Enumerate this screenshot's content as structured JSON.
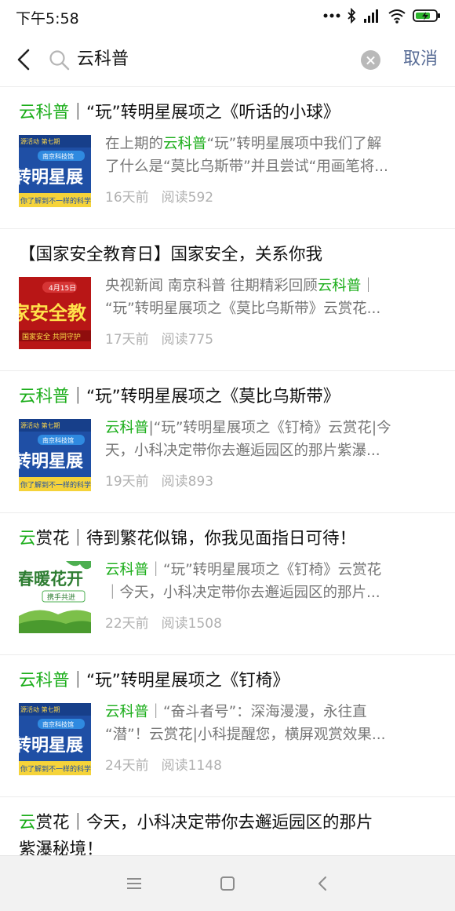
{
  "status_bar": {
    "time": "下午5:58"
  },
  "search": {
    "query": "云科普",
    "cancel_label": "取消"
  },
  "results": [
    {
      "title_hl": "云科普",
      "title_rest": "｜“玩”转明星展项之《听话的小球》",
      "snippet_line1_pre": "在上期的",
      "snippet_line1_hl": "云科普",
      "snippet_line1_post": "“玩”转明星展项中我们了解",
      "snippet_line2": "了什么是“莫比乌斯带”并且尝试“用画笔将...",
      "days": "16天前",
      "reads": "阅读592",
      "thumb": "blue"
    },
    {
      "title_hl": "",
      "title_rest": "【国家安全教育日】国家安全，关系你我",
      "snippet_line1_pre": "央视新闻 南京科普 往期精彩回顾",
      "snippet_line1_hl": "云科普",
      "snippet_line1_post": "｜",
      "snippet_line2": "“玩”转明星展项之《莫比乌斯带》云赏花...",
      "days": "17天前",
      "reads": "阅读775",
      "thumb": "red"
    },
    {
      "title_hl": "云科普",
      "title_rest": "｜“玩”转明星展项之《莫比乌斯带》",
      "snippet_line1_pre": "",
      "snippet_line1_hl": "云科普",
      "snippet_line1_post": "|“玩”转明星展项之《钉椅》云赏花|今",
      "snippet_line2": "天，小科决定带你去邂逅园区的那片紫瀑...",
      "days": "19天前",
      "reads": "阅读893",
      "thumb": "blue"
    },
    {
      "title_hl": "云",
      "title_rest": "赏花｜待到繁花似锦，你我见面指日可待！",
      "snippet_line1_pre": "",
      "snippet_line1_hl": "云科普",
      "snippet_line1_post": "｜“玩”转明星展项之《钉椅》云赏花",
      "snippet_line2": "｜今天，小科决定带你去邂逅园区的那片...",
      "days": "22天前",
      "reads": "阅读1508",
      "thumb": "green"
    },
    {
      "title_hl": "云科普",
      "title_rest": "｜“玩”转明星展项之《钉椅》",
      "snippet_line1_pre": "",
      "snippet_line1_hl": "云科普",
      "snippet_line1_post": "｜“奋斗者号”：深海漫漫，永往直",
      "snippet_line2": "“潜”！云赏花|小科提醒您，横屏观赏效果...",
      "days": "24天前",
      "reads": "阅读1148",
      "thumb": "blue"
    }
  ],
  "last_result": {
    "title_hl": "云",
    "title_rest": "赏花｜今天，小科决定带你去邂逅园区的那片",
    "title_line2": "紫瀑秘境！"
  },
  "thumbnails": {
    "blue": {
      "top_text": "源活动 第七期",
      "tag_text": "南京科技馆",
      "big_text": "转明星展",
      "bottom_text": "你了解到不一样的科学知"
    },
    "red": {
      "date_text": "4月15日",
      "big_text": "家安全教",
      "bottom_text": "国家安全 共同守护"
    },
    "green": {
      "big_text": "春暖花开",
      "sub_text": "携手共进"
    }
  },
  "colors": {
    "highlight": "#1aad19",
    "link": "#576b95",
    "meta": "#b0b0b0"
  },
  "icons": [
    "back-arrow-icon",
    "search-icon",
    "clear-icon",
    "menu-icon",
    "home-icon",
    "nav-back-icon"
  ]
}
